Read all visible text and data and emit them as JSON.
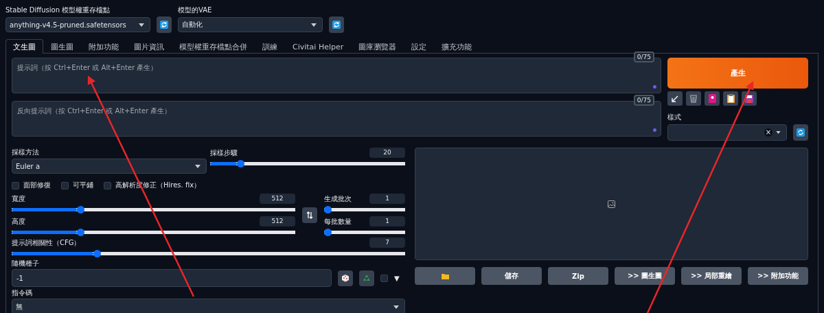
{
  "checkpoint": {
    "label": "Stable Diffusion 模型權重存檔點",
    "value": "anything-v4.5-pruned.safetensors"
  },
  "vae": {
    "label": "模型的VAE",
    "value": "自動化"
  },
  "tabs": [
    {
      "label": "文生圖",
      "selected": true
    },
    {
      "label": "圖生圖",
      "selected": false
    },
    {
      "label": "附加功能",
      "selected": false
    },
    {
      "label": "圖片資訊",
      "selected": false
    },
    {
      "label": "模型權重存檔點合併",
      "selected": false
    },
    {
      "label": "訓練",
      "selected": false
    },
    {
      "label": "Civitai Helper",
      "selected": false
    },
    {
      "label": "圖庫瀏覽器",
      "selected": false
    },
    {
      "label": "設定",
      "selected": false
    },
    {
      "label": "擴充功能",
      "selected": false
    }
  ],
  "prompt": {
    "counter": "0/75",
    "placeholder": "提示詞（按 Ctrl+Enter 或 Alt+Enter 產生）"
  },
  "negative_prompt": {
    "counter": "0/75",
    "placeholder": "反向提示詞（按 Ctrl+Enter 或 Alt+Enter 產生）"
  },
  "generate_button": "產生",
  "tool_buttons": [
    {
      "kind": "arrow"
    },
    {
      "kind": "trash"
    },
    {
      "kind": "card"
    },
    {
      "kind": "clipboard"
    },
    {
      "kind": "save"
    }
  ],
  "styles": {
    "label": "樣式",
    "clear": "×"
  },
  "sampler": {
    "label": "採樣方法",
    "value": "Euler a"
  },
  "steps": {
    "label": "採樣步驟",
    "value": "20",
    "level": 0.137
  },
  "checkboxes": [
    {
      "label": "面部修復",
      "checked": false
    },
    {
      "label": "可平鋪",
      "checked": false
    },
    {
      "label": "高解析度修正（Hires. fix）",
      "checked": false
    }
  ],
  "width": {
    "label": "寬度",
    "value": "512",
    "level": 0.23
  },
  "height": {
    "label": "高度",
    "value": "512",
    "level": 0.23
  },
  "batch_count": {
    "label": "生成批次",
    "value": "1",
    "level": 0
  },
  "batch_size": {
    "label": "每批數量",
    "value": "1",
    "level": 0
  },
  "cfg": {
    "label": "提示詞相關性（CFG）",
    "value": "7",
    "level": 0.207
  },
  "seed": {
    "label": "隨機種子",
    "value": "-1",
    "extra_checked": false,
    "extra_toggle": "▼"
  },
  "script": {
    "label": "指令碼",
    "value": "無"
  },
  "output_buttons": [
    {
      "kind": "folder"
    },
    {
      "kind": "text",
      "label": "儲存"
    },
    {
      "kind": "text",
      "label": "Zip"
    },
    {
      "kind": "text",
      "label": ">> 圖生圖"
    },
    {
      "kind": "text",
      "label": ">> 局部重繪"
    },
    {
      "kind": "text",
      "label": ">> 附加功能"
    }
  ],
  "annotations": [
    {
      "kind": "arrow"
    },
    {
      "kind": "arrow"
    }
  ]
}
